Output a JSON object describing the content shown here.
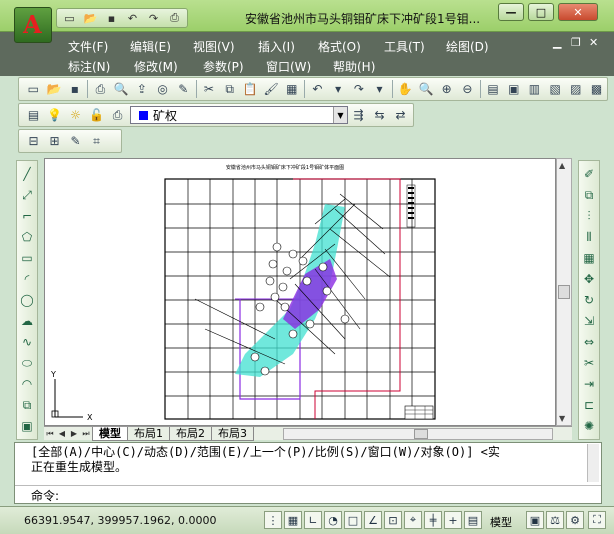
{
  "window": {
    "title": "安徽省池州市马头铜钼矿床下冲矿段1号钼...",
    "app_logo": "A",
    "controls": {
      "minimize": "—",
      "restore": "□",
      "close": "✕"
    }
  },
  "quick_access": [
    "new-icon",
    "open-icon",
    "save-icon",
    "undo-icon",
    "redo-icon",
    "plot-icon"
  ],
  "menus": {
    "row1": [
      "文件(F)",
      "编辑(E)",
      "视图(V)",
      "插入(I)",
      "格式(O)",
      "工具(T)",
      "绘图(D)"
    ],
    "row2": [
      "标注(N)",
      "修改(M)",
      "参数(P)",
      "窗口(W)",
      "帮助(H)"
    ]
  },
  "layer": {
    "current": "矿权",
    "swatch_color": "#0000ff"
  },
  "layout_tabs": {
    "tabs": [
      "模型",
      "布局1",
      "布局2",
      "布局3"
    ],
    "active_index": 0
  },
  "drawing": {
    "title": "安徽省池州市马头铜钼矿床下冲矿段1号钼矿体平面图",
    "ucs_y": "Y",
    "ucs_x": "X"
  },
  "command": {
    "line1": "[全部(A)/中心(C)/动态(D)/范围(E)/上一个(P)/比例(S)/窗口(W)/对象(O)] <实",
    "line2": "正在重生成模型。",
    "prompt": "命令:",
    "input_value": ""
  },
  "statusbar": {
    "coords": "66391.9547, 399957.1962, 0.0000",
    "model_label": "模型"
  },
  "colors": {
    "menubar": "#5e6a5d",
    "titlebar": "#9ccf6a",
    "ore_body": "#40e0d0",
    "ore_core": "#8a2be2"
  }
}
